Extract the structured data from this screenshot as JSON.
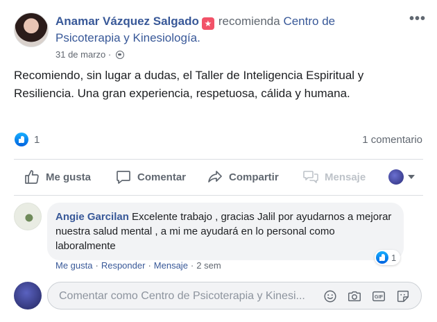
{
  "post": {
    "author": "Anamar Vázquez Salgado",
    "recommend_text": "recomienda",
    "page_name": "Centro de Psicoterapia y Kinesiología.",
    "date": "31 de marzo",
    "dot": "·",
    "more": "•••",
    "body": "Recomiendo, sin lugar a dudas, el Taller de Inteligencia Espiritual y Resiliencia. Una gran experiencia, respetuosa, cálida y humana.",
    "reaction_count": "1",
    "comment_count": "1 comentario",
    "badge_icon": "★"
  },
  "actions": {
    "like": "Me gusta",
    "comment": "Comentar",
    "share": "Compartir",
    "message": "Mensaje"
  },
  "comment": {
    "author": "Angie Garcilan",
    "text": "Excelente trabajo , gracias Jalil por ayudarnos a mejorar nuestra salud mental , a mi me ayudará en lo personal como laboralmente",
    "like_count": "1",
    "like": "Me gusta",
    "reply": "Responder",
    "message": "Mensaje",
    "time": "2 sem",
    "sep": "·"
  },
  "composer": {
    "placeholder": "Comentar como Centro de Psicoterapia y Kinesi..."
  },
  "colors": {
    "link": "#385898",
    "muted": "#606770",
    "like_blue": "#1877f2",
    "badge": "#f25268"
  }
}
